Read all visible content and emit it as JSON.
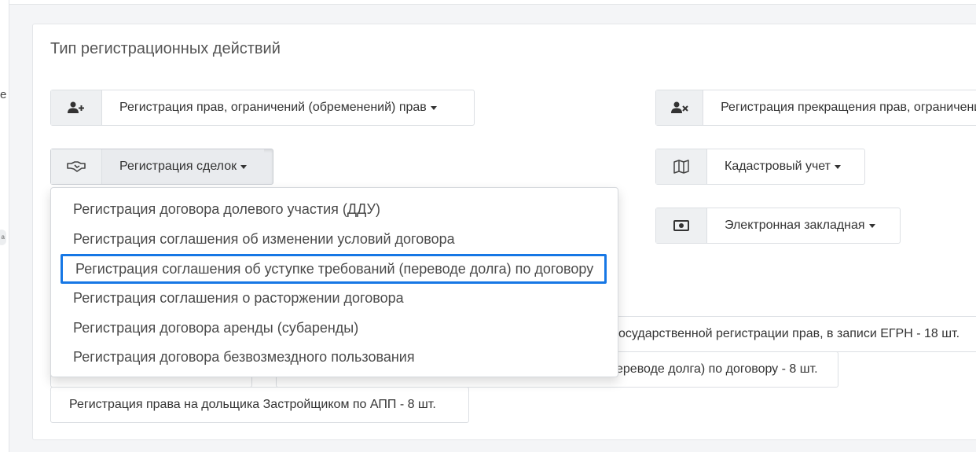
{
  "edge": {
    "fragment_text": "е",
    "fragment_badge": "а"
  },
  "section": {
    "title": "Тип регистрационных действий"
  },
  "buttons": {
    "rights": {
      "label": "Регистрация прав, ограничений (обременений) прав",
      "icon": "user-plus-icon"
    },
    "termination": {
      "label": "Регистрация прекращения прав, ограничений",
      "icon": "user-times-icon"
    },
    "deals": {
      "label": "Регистрация сделок",
      "icon": "handshake-icon"
    },
    "cadastral": {
      "label": "Кадастровый учет",
      "icon": "map-icon"
    },
    "mortgage": {
      "label": "Электронная закладная",
      "icon": "money-icon"
    }
  },
  "dropdown": {
    "items": [
      "Регистрация договора долевого участия (ДДУ)",
      "Регистрация соглашения об изменении условий договора",
      "Регистрация соглашения об уступке требований (переводе долга) по договору",
      "Регистрация соглашения о расторжении договора",
      "Регистрация договора аренды (субаренды)",
      "Регистрация договора безвозмездного пользования"
    ],
    "highlighted_index": 2,
    "highlight_color": "#1677e5"
  },
  "history": {
    "item1": "осударственной регистрации прав, в записи ЕГРН - 18 шт.",
    "item2": "ереводе долга) по договору - 8 шт.",
    "item3": "Регистрация права на дольщика Застройщиком по АПП - 8 шт."
  }
}
